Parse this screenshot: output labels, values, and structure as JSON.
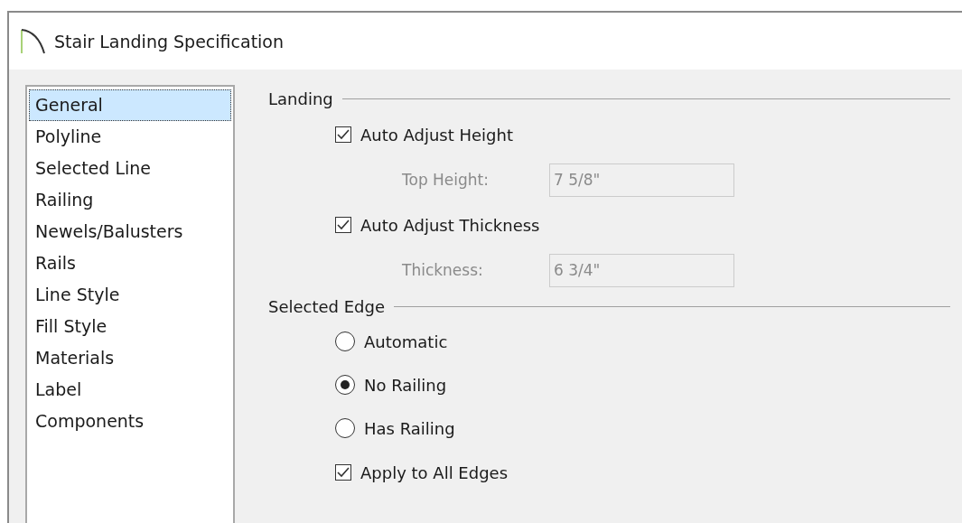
{
  "window": {
    "title": "Stair Landing Specification"
  },
  "sidebar": {
    "items": [
      {
        "label": "General",
        "selected": true
      },
      {
        "label": "Polyline",
        "selected": false
      },
      {
        "label": "Selected Line",
        "selected": false
      },
      {
        "label": "Railing",
        "selected": false
      },
      {
        "label": "Newels/Balusters",
        "selected": false
      },
      {
        "label": "Rails",
        "selected": false
      },
      {
        "label": "Line Style",
        "selected": false
      },
      {
        "label": "Fill Style",
        "selected": false
      },
      {
        "label": "Materials",
        "selected": false
      },
      {
        "label": "Label",
        "selected": false
      },
      {
        "label": "Components",
        "selected": false
      }
    ]
  },
  "sections": [
    {
      "title": "Landing",
      "rows": [
        {
          "kind": "checkbox",
          "label": "Auto Adjust Height",
          "checked": true
        },
        {
          "kind": "field",
          "label": "Top Height:",
          "value": "7 5/8\"",
          "disabled": true
        },
        {
          "kind": "checkbox",
          "label": "Auto Adjust Thickness",
          "checked": true
        },
        {
          "kind": "field",
          "label": "Thickness:",
          "value": "6 3/4\"",
          "disabled": true
        }
      ]
    },
    {
      "title": "Selected Edge",
      "rows": [
        {
          "kind": "radio",
          "label": "Automatic",
          "selected": false
        },
        {
          "kind": "radio",
          "label": "No Railing",
          "selected": true
        },
        {
          "kind": "radio",
          "label": "Has Railing",
          "selected": false
        },
        {
          "kind": "checkbox",
          "label": "Apply to All Edges",
          "checked": true
        }
      ]
    }
  ]
}
